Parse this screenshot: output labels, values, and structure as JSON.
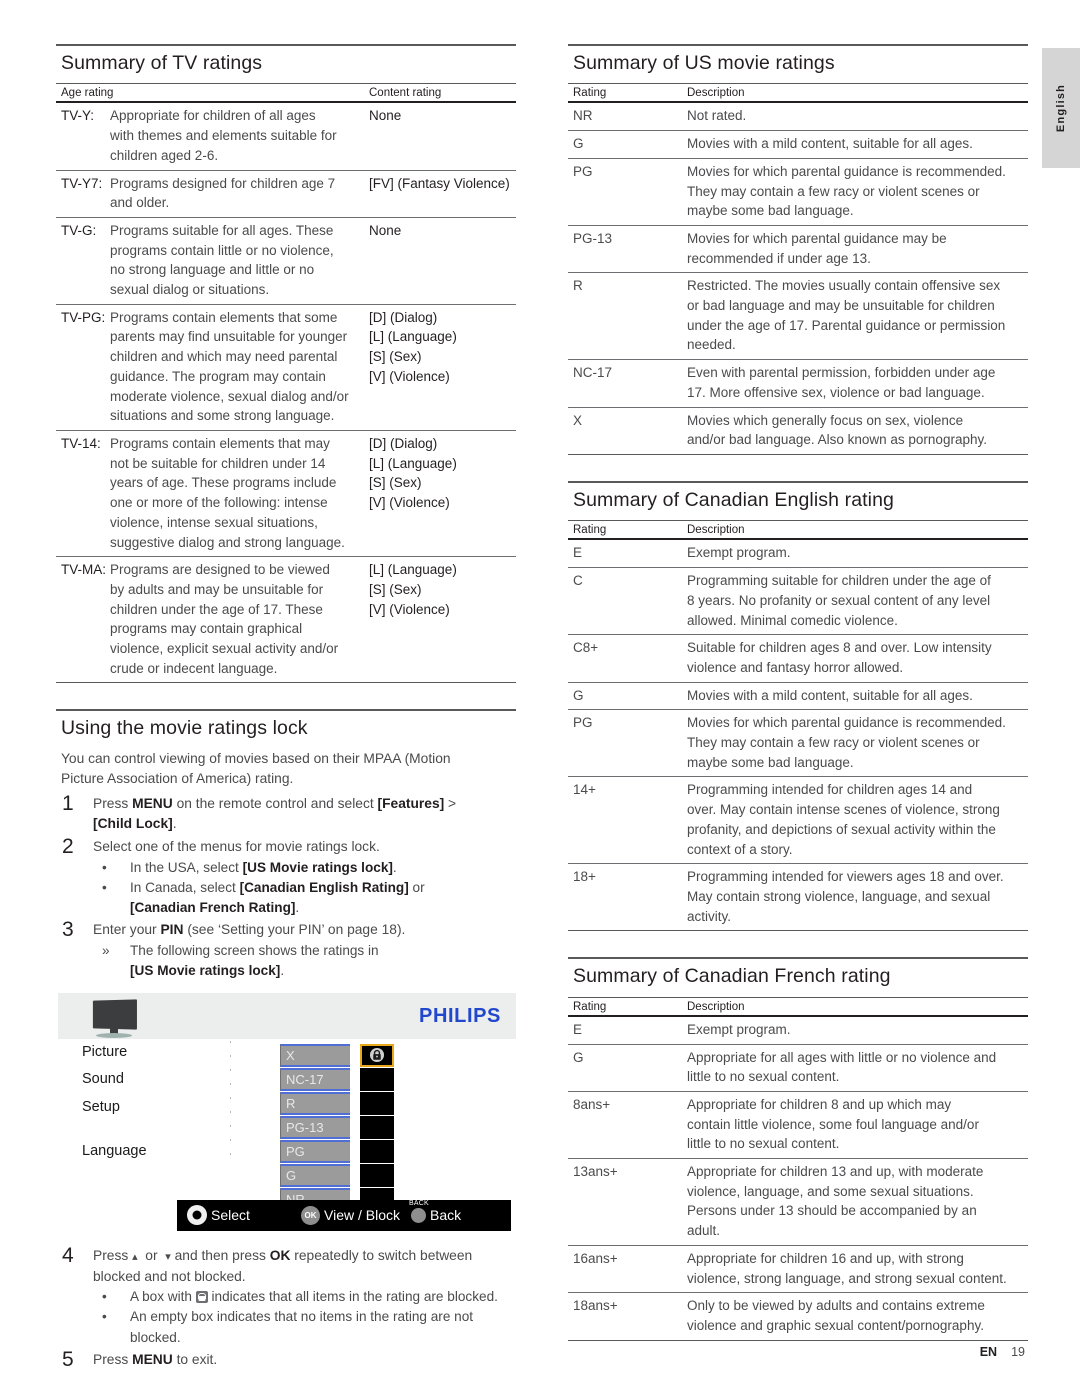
{
  "side_tab": {
    "label": "English"
  },
  "footer": {
    "en": "EN",
    "page": "19"
  },
  "tv_ratings": {
    "title": "Summary of TV ratings",
    "headers": {
      "age": "Age rating",
      "content": "Content rating"
    },
    "rows": [
      {
        "code": "TV-Y:",
        "desc": [
          "Appropriate for children of all ages",
          "with themes and elements suitable for",
          "children aged 2-6."
        ],
        "content": [
          "None"
        ]
      },
      {
        "code": "TV-Y7:",
        "desc": [
          "Programs designed for children age 7",
          "and older."
        ],
        "content": [
          "[FV] (Fantasy Violence)"
        ]
      },
      {
        "code": "TV-G:",
        "desc": [
          "Programs suitable for all ages. These",
          "programs contain little or no violence,",
          "no strong language and little or no",
          "sexual dialog or situations."
        ],
        "content": [
          "None"
        ]
      },
      {
        "code": "TV-PG:",
        "desc": [
          "Programs contain elements that some",
          "parents may find unsuitable for younger",
          "children and which may need parental",
          "guidance. The program may contain",
          "moderate violence, sexual dialog and/or",
          "situations and some strong language."
        ],
        "content": [
          "[D] (Dialog)",
          "[L] (Language)",
          "[S] (Sex)",
          "[V] (Violence)"
        ]
      },
      {
        "code": "TV-14:",
        "desc": [
          "Programs contain elements that may",
          "not be suitable for children under 14",
          "years of age. These programs include",
          "one or more of the following: intense",
          "violence, intense sexual situations,",
          "suggestive dialog and strong language."
        ],
        "content": [
          "[D] (Dialog)",
          "[L] (Language)",
          "[S] (Sex)",
          "[V] (Violence)"
        ]
      },
      {
        "code": "TV-MA:",
        "desc": [
          "Programs are designed to be viewed",
          "by adults and may be unsuitable for",
          "children under the age of 17. These",
          "programs may contain graphical",
          "violence, explicit sexual activity and/or",
          "crude or indecent language."
        ],
        "content": [
          "[L] (Language)",
          "[S] (Sex)",
          "[V] (Violence)"
        ]
      }
    ]
  },
  "movie_lock": {
    "title": "Using the movie ratings lock",
    "intro": [
      "You can control viewing of movies based on their MPAA (Motion",
      "Picture Association of America) rating."
    ],
    "steps": [
      {
        "num": "1",
        "lines_html": [
          "Press <b>MENU</b> on the remote control and select <b>[Features]</b> &gt;",
          "<b>[Child Lock]</b>."
        ]
      },
      {
        "num": "2",
        "lines_html": [
          "Select one of the menus for movie ratings lock."
        ],
        "sub": [
          {
            "bullet": "•",
            "lines_html": [
              "In the USA, select <b>[US Movie ratings lock]</b>."
            ]
          },
          {
            "bullet": "•",
            "lines_html": [
              "In Canada, select <b>[Canadian English Rating]</b> or",
              "<b>[Canadian French Rating]</b>."
            ]
          }
        ]
      },
      {
        "num": "3",
        "lines_html": [
          "Enter your <b>PIN</b> (see ‘Setting your PIN’ on page 18)."
        ],
        "sub": [
          {
            "bullet": "»",
            "lines_html": [
              "The following screen shows the ratings in",
              "<b>[US Movie ratings lock]</b>."
            ]
          }
        ]
      },
      {
        "num": "4",
        "lines_html": [
          "Press <span class=\"arrow-glyph\">▴</span>&nbsp; or &nbsp;<span class=\"arrow-glyph\">▾</span> and then press <b>OK</b> repeatedly to switch between",
          "blocked and not blocked."
        ],
        "sub": [
          {
            "bullet": "•",
            "lines_html": [
              "A box with <span class=\"icon-inline\"></span> indicates that all items in the rating are blocked."
            ]
          },
          {
            "bullet": "•",
            "lines_html": [
              "An empty box indicates that no items in the rating are not",
              "blocked."
            ]
          }
        ]
      },
      {
        "num": "5",
        "lines_html": [
          "Press <b>MENU</b> to exit."
        ]
      }
    ]
  },
  "tv_mockup": {
    "brand": "PHILIPS",
    "menu_items": [
      "Picture",
      "Sound",
      "Setup",
      "Language"
    ],
    "ratings": [
      {
        "label": "X",
        "blocked": true
      },
      {
        "label": "NC-17",
        "blocked": false
      },
      {
        "label": "R",
        "blocked": false
      },
      {
        "label": "PG-13",
        "blocked": false
      },
      {
        "label": "PG",
        "blocked": false
      },
      {
        "label": "G",
        "blocked": false
      },
      {
        "label": "NR",
        "blocked": false
      }
    ],
    "footbar": {
      "select": "Select",
      "view_block": "View / Block",
      "back": "Back",
      "ok_label": "OK",
      "back_label": "BACK"
    },
    "colors": {
      "selected_border": "#e7a81c",
      "pill_bg": "#9b9b9b",
      "pill_border": "#4f6fd4",
      "brand": "#2148cc"
    }
  },
  "us_movie": {
    "title": "Summary of US movie ratings",
    "headers": {
      "rating": "Rating",
      "description": "Description"
    },
    "rows": [
      {
        "rating": "NR",
        "desc": [
          "Not rated."
        ]
      },
      {
        "rating": "G",
        "desc": [
          "Movies with a mild content, suitable for all ages."
        ]
      },
      {
        "rating": "PG",
        "desc": [
          "Movies for which parental guidance is recommended.",
          "They may contain a few racy or violent scenes or",
          "maybe some bad language."
        ]
      },
      {
        "rating": "PG-13",
        "desc": [
          "Movies for which parental guidance may be",
          "recommended if under age 13."
        ]
      },
      {
        "rating": "R",
        "desc": [
          "Restricted. The movies usually contain offensive sex",
          "or bad language and may be unsuitable for children",
          "under the age of 17. Parental guidance or permission",
          "needed."
        ]
      },
      {
        "rating": "NC-17",
        "desc": [
          "Even with parental permission, forbidden under age",
          "17. More offensive sex, violence or bad language."
        ]
      },
      {
        "rating": "X",
        "desc": [
          "Movies which generally focus on sex, violence",
          "and/or bad language. Also known as pornography."
        ]
      }
    ]
  },
  "canadian_english": {
    "title": "Summary of Canadian English rating",
    "headers": {
      "rating": "Rating",
      "description": "Description"
    },
    "rows": [
      {
        "rating": "E",
        "desc": [
          "Exempt program."
        ]
      },
      {
        "rating": "C",
        "desc": [
          "Programming suitable for children under the age of",
          "8 years. No profanity or sexual content of any level",
          "allowed. Minimal comedic violence."
        ]
      },
      {
        "rating": "C8+",
        "desc": [
          "Suitable for children ages 8 and over. Low intensity",
          "violence and fantasy horror allowed."
        ]
      },
      {
        "rating": "G",
        "desc": [
          "Movies with a mild content, suitable for all ages."
        ]
      },
      {
        "rating": "PG",
        "desc": [
          "Movies for which parental guidance is recommended.",
          "They may contain a few racy or violent scenes or",
          "maybe some bad language."
        ]
      },
      {
        "rating": "14+",
        "desc": [
          "Programming intended for children ages 14 and",
          "over. May contain intense scenes of violence, strong",
          "profanity, and depictions of sexual activity within the",
          "context of a story."
        ]
      },
      {
        "rating": "18+",
        "desc": [
          "Programming intended for viewers ages 18 and over.",
          "May contain strong violence, language, and sexual",
          "activity."
        ]
      }
    ]
  },
  "canadian_french": {
    "title": "Summary of Canadian French rating",
    "headers": {
      "rating": "Rating",
      "description": "Description"
    },
    "rows": [
      {
        "rating": "E",
        "desc": [
          "Exempt program."
        ]
      },
      {
        "rating": "G",
        "desc": [
          "Appropriate for all ages with little or no violence and",
          "little to no sexual content."
        ]
      },
      {
        "rating": "8ans+",
        "desc": [
          "Appropriate for children 8 and up which may",
          "contain little violence, some foul language and/or",
          "little to no sexual content."
        ]
      },
      {
        "rating": "13ans+",
        "desc": [
          "Appropriate for children 13 and up, with moderate",
          "violence, language, and some sexual situations.",
          "Persons under 13 should be accompanied by an",
          "adult."
        ]
      },
      {
        "rating": "16ans+",
        "desc": [
          "Appropriate for children 16 and up, with strong",
          "violence, strong language, and strong sexual content."
        ]
      },
      {
        "rating": "18ans+",
        "desc": [
          "Only to be viewed by adults and contains extreme",
          "violence and graphic sexual content/pornography."
        ]
      }
    ]
  }
}
